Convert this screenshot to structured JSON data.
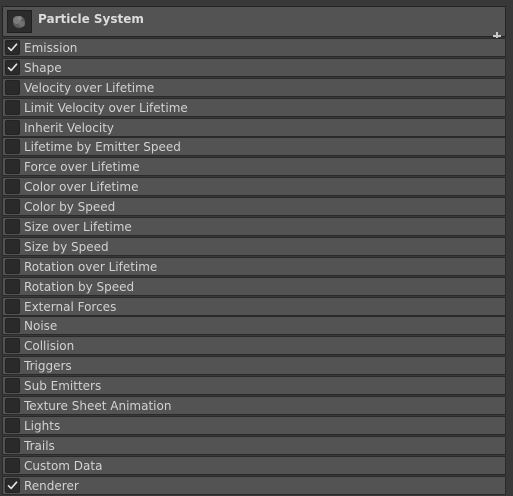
{
  "header": {
    "title": "Particle System",
    "thumbnail_icon": "particle-system-preview-icon",
    "add_icon": "plus-icon"
  },
  "colors": {
    "background": "#383838",
    "row_background": "#535353",
    "checkbox_background": "#2a2a2a",
    "check_color": "#e6e6e6",
    "text": "#d2d2d2"
  },
  "modules": [
    {
      "label": "Emission",
      "checked": true
    },
    {
      "label": "Shape",
      "checked": true
    },
    {
      "label": "Velocity over Lifetime",
      "checked": false
    },
    {
      "label": "Limit Velocity over Lifetime",
      "checked": false
    },
    {
      "label": "Inherit Velocity",
      "checked": false
    },
    {
      "label": "Lifetime by Emitter Speed",
      "checked": false
    },
    {
      "label": "Force over Lifetime",
      "checked": false
    },
    {
      "label": "Color over Lifetime",
      "checked": false
    },
    {
      "label": "Color by Speed",
      "checked": false
    },
    {
      "label": "Size over Lifetime",
      "checked": false
    },
    {
      "label": "Size by Speed",
      "checked": false
    },
    {
      "label": "Rotation over Lifetime",
      "checked": false
    },
    {
      "label": "Rotation by Speed",
      "checked": false
    },
    {
      "label": "External Forces",
      "checked": false
    },
    {
      "label": "Noise",
      "checked": false
    },
    {
      "label": "Collision",
      "checked": false
    },
    {
      "label": "Triggers",
      "checked": false
    },
    {
      "label": "Sub Emitters",
      "checked": false
    },
    {
      "label": "Texture Sheet Animation",
      "checked": false
    },
    {
      "label": "Lights",
      "checked": false
    },
    {
      "label": "Trails",
      "checked": false
    },
    {
      "label": "Custom Data",
      "checked": false
    },
    {
      "label": "Renderer",
      "checked": true
    }
  ]
}
